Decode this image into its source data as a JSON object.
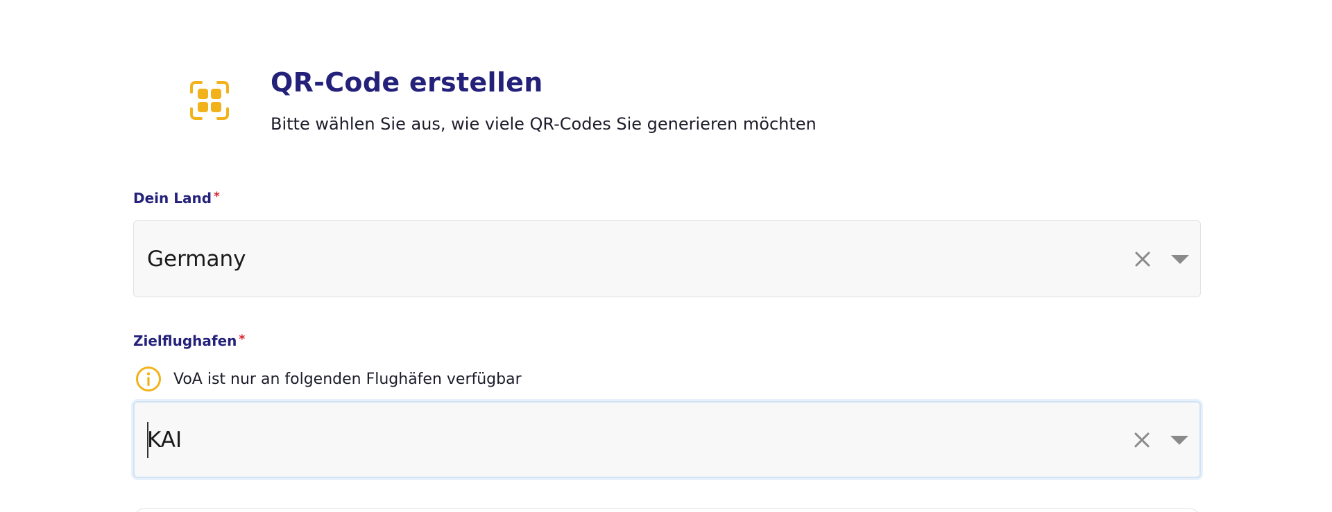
{
  "header": {
    "icon": "qr-code-icon",
    "title": "QR-Code erstellen",
    "subtitle": "Bitte wählen Sie aus, wie viele QR-Codes Sie generieren möchten"
  },
  "country_field": {
    "label": "Dein Land",
    "required_mark": "*",
    "value": "Germany",
    "clear_icon": "close-icon",
    "dropdown_icon": "caret-down-icon"
  },
  "airport_field": {
    "label": "Zielflughafen",
    "required_mark": "*",
    "info_icon": "info-icon",
    "info_text": "VoA ist nur an folgenden Flughäfen verfügbar",
    "value": "KAI",
    "clear_icon": "close-icon",
    "dropdown_icon": "caret-down-icon"
  },
  "colors": {
    "accent": "#24217a",
    "required": "#d8202b",
    "icon_yellow": "#f2b21b",
    "focus_border": "#cfe3f5"
  }
}
